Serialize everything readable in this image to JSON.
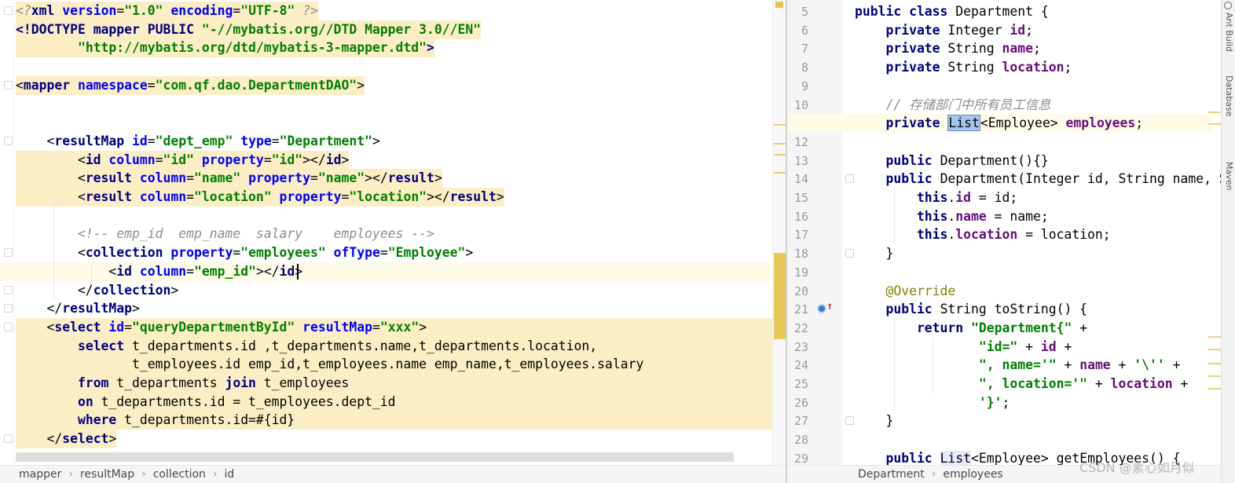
{
  "left_editor": {
    "lines": [
      {
        "segments": [
          {
            "t": "<?",
            "c": "pi"
          },
          {
            "t": "xml ",
            "c": "kw"
          },
          {
            "t": "version",
            "c": "attr"
          },
          {
            "t": "=",
            "c": "pl"
          },
          {
            "t": "\"1.0\" ",
            "c": "val"
          },
          {
            "t": "encoding",
            "c": "attr"
          },
          {
            "t": "=",
            "c": "pl"
          },
          {
            "t": "\"UTF-8\" ",
            "c": "val"
          },
          {
            "t": "?>",
            "c": "pi"
          }
        ]
      },
      {
        "segments": [
          {
            "t": "<!DOCTYPE ",
            "c": "tag"
          },
          {
            "t": "mapper ",
            "c": "tag"
          },
          {
            "t": "PUBLIC ",
            "c": "tag"
          },
          {
            "t": "\"-//mybatis.org//DTD Mapper 3.0//EN\"",
            "c": "val"
          }
        ]
      },
      {
        "segments": [
          {
            "t": "        ",
            "c": "pl"
          },
          {
            "t": "\"http://mybatis.org/dtd/mybatis-3-mapper.dtd\"",
            "c": "val"
          },
          {
            "t": ">",
            "c": "tag"
          }
        ]
      },
      {
        "segments": []
      },
      {
        "segments": [
          {
            "t": "<",
            "c": "pl"
          },
          {
            "t": "mapper ",
            "c": "tag"
          },
          {
            "t": "namespace",
            "c": "attr"
          },
          {
            "t": "=",
            "c": "pl"
          },
          {
            "t": "\"com.qf.dao.DepartmentDAO\"",
            "c": "val"
          },
          {
            "t": ">",
            "c": "pl"
          }
        ]
      },
      {
        "segments": []
      },
      {
        "segments": []
      },
      {
        "segments": [
          {
            "t": "    <",
            "c": "pl"
          },
          {
            "t": "resultMap ",
            "c": "tag"
          },
          {
            "t": "id",
            "c": "attr"
          },
          {
            "t": "=",
            "c": "pl"
          },
          {
            "t": "\"dept_emp\" ",
            "c": "val"
          },
          {
            "t": "type",
            "c": "attr"
          },
          {
            "t": "=",
            "c": "pl"
          },
          {
            "t": "\"Department\"",
            "c": "val"
          },
          {
            "t": ">",
            "c": "pl"
          }
        ]
      },
      {
        "segments": [
          {
            "t": "        <",
            "c": "pl"
          },
          {
            "t": "id ",
            "c": "tag"
          },
          {
            "t": "column",
            "c": "attr"
          },
          {
            "t": "=",
            "c": "pl"
          },
          {
            "t": "\"id\" ",
            "c": "val"
          },
          {
            "t": "property",
            "c": "attr"
          },
          {
            "t": "=",
            "c": "pl"
          },
          {
            "t": "\"id\"",
            "c": "val"
          },
          {
            "t": "></",
            "c": "pl"
          },
          {
            "t": "id",
            "c": "tag"
          },
          {
            "t": ">",
            "c": "pl"
          }
        ]
      },
      {
        "segments": [
          {
            "t": "        <",
            "c": "pl"
          },
          {
            "t": "result ",
            "c": "tag"
          },
          {
            "t": "column",
            "c": "attr"
          },
          {
            "t": "=",
            "c": "pl"
          },
          {
            "t": "\"name\" ",
            "c": "val"
          },
          {
            "t": "property",
            "c": "attr"
          },
          {
            "t": "=",
            "c": "pl"
          },
          {
            "t": "\"name\"",
            "c": "val"
          },
          {
            "t": "></",
            "c": "pl"
          },
          {
            "t": "result",
            "c": "tag"
          },
          {
            "t": ">",
            "c": "pl"
          }
        ]
      },
      {
        "segments": [
          {
            "t": "        <",
            "c": "pl"
          },
          {
            "t": "result ",
            "c": "tag"
          },
          {
            "t": "column",
            "c": "attr"
          },
          {
            "t": "=",
            "c": "pl"
          },
          {
            "t": "\"location\" ",
            "c": "val"
          },
          {
            "t": "property",
            "c": "attr"
          },
          {
            "t": "=",
            "c": "pl"
          },
          {
            "t": "\"location\"",
            "c": "val"
          },
          {
            "t": "></",
            "c": "pl"
          },
          {
            "t": "result",
            "c": "tag"
          },
          {
            "t": ">",
            "c": "pl"
          }
        ]
      },
      {
        "segments": []
      },
      {
        "segments": [
          {
            "t": "        <!-- emp_id  emp_name  salary    employees -->",
            "c": "cmt"
          }
        ]
      },
      {
        "segments": [
          {
            "t": "        <",
            "c": "pl"
          },
          {
            "t": "collection ",
            "c": "tag"
          },
          {
            "t": "property",
            "c": "attr"
          },
          {
            "t": "=",
            "c": "pl"
          },
          {
            "t": "\"employees\" ",
            "c": "val"
          },
          {
            "t": "ofType",
            "c": "attr"
          },
          {
            "t": "=",
            "c": "pl"
          },
          {
            "t": "\"Employee\"",
            "c": "val"
          },
          {
            "t": ">",
            "c": "pl"
          }
        ]
      },
      {
        "segments": [
          {
            "t": "            <",
            "c": "pl"
          },
          {
            "t": "id ",
            "c": "tag"
          },
          {
            "t": "column",
            "c": "attr"
          },
          {
            "t": "=",
            "c": "pl"
          },
          {
            "t": "\"emp_id\"",
            "c": "val"
          },
          {
            "t": "></",
            "c": "pl"
          },
          {
            "t": "id",
            "c": "tag"
          },
          {
            "t": ">",
            "c": "pl"
          }
        ]
      },
      {
        "segments": [
          {
            "t": "        </",
            "c": "pl"
          },
          {
            "t": "collection",
            "c": "tag"
          },
          {
            "t": ">",
            "c": "pl"
          }
        ]
      },
      {
        "segments": [
          {
            "t": "    </",
            "c": "pl"
          },
          {
            "t": "resultMap",
            "c": "tag"
          },
          {
            "t": ">",
            "c": "pl"
          }
        ]
      },
      {
        "segments": [
          {
            "t": "    <",
            "c": "pl"
          },
          {
            "t": "select ",
            "c": "tag"
          },
          {
            "t": "id",
            "c": "attr"
          },
          {
            "t": "=",
            "c": "pl"
          },
          {
            "t": "\"queryDepartmentById\" ",
            "c": "val"
          },
          {
            "t": "resultMap",
            "c": "attr"
          },
          {
            "t": "=",
            "c": "pl"
          },
          {
            "t": "\"xxx\"",
            "c": "val"
          },
          {
            "t": ">",
            "c": "pl"
          }
        ]
      },
      {
        "segments": [
          {
            "t": "        ",
            "c": "pl"
          },
          {
            "t": "select ",
            "c": "kw"
          },
          {
            "t": "t_departments.id ,t_departments.name,t_departments.location,",
            "c": "pl"
          }
        ]
      },
      {
        "segments": [
          {
            "t": "               t_employees.id emp_id,t_employees.name emp_name,t_employees.salary",
            "c": "pl"
          }
        ]
      },
      {
        "segments": [
          {
            "t": "        ",
            "c": "pl"
          },
          {
            "t": "from ",
            "c": "kw"
          },
          {
            "t": "t_departments ",
            "c": "pl"
          },
          {
            "t": "join ",
            "c": "kw"
          },
          {
            "t": "t_employees",
            "c": "pl"
          }
        ]
      },
      {
        "segments": [
          {
            "t": "        ",
            "c": "pl"
          },
          {
            "t": "on ",
            "c": "kw"
          },
          {
            "t": "t_departments.id = t_employees.dept_id",
            "c": "pl"
          }
        ]
      },
      {
        "segments": [
          {
            "t": "        ",
            "c": "pl"
          },
          {
            "t": "where ",
            "c": "kw"
          },
          {
            "t": "t_departments.id=#{id}",
            "c": "pl"
          }
        ]
      },
      {
        "segments": [
          {
            "t": "    </",
            "c": "pl"
          },
          {
            "t": "select",
            "c": "tag"
          },
          {
            "t": ">",
            "c": "pl"
          }
        ]
      }
    ],
    "breadcrumb": [
      "mapper",
      "resultMap",
      "collection",
      "id"
    ]
  },
  "right_editor": {
    "line_numbers": [
      "5",
      "6",
      "7",
      "8",
      "9",
      "10",
      "11",
      "12",
      "13",
      "14",
      "15",
      "16",
      "17",
      "18",
      "19",
      "20",
      "21",
      "22",
      "23",
      "24",
      "25",
      "26",
      "27",
      "28",
      "29"
    ],
    "lines": [
      {
        "segments": [
          {
            "t": "public class ",
            "c": "jkw"
          },
          {
            "t": "Department {",
            "c": "pl"
          }
        ]
      },
      {
        "segments": [
          {
            "t": "    private ",
            "c": "jkw"
          },
          {
            "t": "Integer ",
            "c": "pl"
          },
          {
            "t": "id",
            "c": "fld"
          },
          {
            "t": ";",
            "c": "pl"
          }
        ]
      },
      {
        "segments": [
          {
            "t": "    private ",
            "c": "jkw"
          },
          {
            "t": "String ",
            "c": "pl"
          },
          {
            "t": "name",
            "c": "fld"
          },
          {
            "t": ";",
            "c": "pl"
          }
        ]
      },
      {
        "segments": [
          {
            "t": "    private ",
            "c": "jkw"
          },
          {
            "t": "String ",
            "c": "pl"
          },
          {
            "t": "location",
            "c": "fld"
          },
          {
            "t": ";",
            "c": "pl"
          }
        ]
      },
      {
        "segments": []
      },
      {
        "segments": [
          {
            "t": "    // 存储部门中所有员工信息",
            "c": "cmt"
          }
        ]
      },
      {
        "segments": [
          {
            "t": "    private ",
            "c": "jkw"
          },
          {
            "t": "List",
            "c": "sel"
          },
          {
            "t": "<Employee> ",
            "c": "pl"
          },
          {
            "t": "employees",
            "c": "fld"
          },
          {
            "t": ";",
            "c": "pl"
          }
        ]
      },
      {
        "segments": []
      },
      {
        "segments": [
          {
            "t": "    public ",
            "c": "jkw"
          },
          {
            "t": "Department(){}",
            "c": "pl"
          }
        ]
      },
      {
        "segments": [
          {
            "t": "    public ",
            "c": "jkw"
          },
          {
            "t": "Department(Integer id, String name, String location) {",
            "c": "pl"
          }
        ]
      },
      {
        "segments": [
          {
            "t": "        this",
            "c": "jkw"
          },
          {
            "t": ".",
            "c": "pl"
          },
          {
            "t": "id",
            "c": "fld"
          },
          {
            "t": " = id;",
            "c": "pl"
          }
        ]
      },
      {
        "segments": [
          {
            "t": "        this",
            "c": "jkw"
          },
          {
            "t": ".",
            "c": "pl"
          },
          {
            "t": "name",
            "c": "fld"
          },
          {
            "t": " = name;",
            "c": "pl"
          }
        ]
      },
      {
        "segments": [
          {
            "t": "        this",
            "c": "jkw"
          },
          {
            "t": ".",
            "c": "pl"
          },
          {
            "t": "location",
            "c": "fld"
          },
          {
            "t": " = location;",
            "c": "pl"
          }
        ]
      },
      {
        "segments": [
          {
            "t": "    }",
            "c": "pl"
          }
        ]
      },
      {
        "segments": []
      },
      {
        "segments": [
          {
            "t": "    @Override",
            "c": "ann"
          }
        ]
      },
      {
        "segments": [
          {
            "t": "    public ",
            "c": "jkw"
          },
          {
            "t": "String toString() {",
            "c": "pl"
          }
        ]
      },
      {
        "segments": [
          {
            "t": "        return ",
            "c": "jkw"
          },
          {
            "t": "\"Department{\" ",
            "c": "str"
          },
          {
            "t": "+",
            "c": "pl"
          }
        ]
      },
      {
        "segments": [
          {
            "t": "                ",
            "c": "pl"
          },
          {
            "t": "\"id=\" ",
            "c": "str"
          },
          {
            "t": "+ ",
            "c": "pl"
          },
          {
            "t": "id ",
            "c": "fld"
          },
          {
            "t": "+",
            "c": "pl"
          }
        ]
      },
      {
        "segments": [
          {
            "t": "                ",
            "c": "pl"
          },
          {
            "t": "\", name='\" ",
            "c": "str"
          },
          {
            "t": "+ ",
            "c": "pl"
          },
          {
            "t": "name ",
            "c": "fld"
          },
          {
            "t": "+ ",
            "c": "pl"
          },
          {
            "t": "'\\''",
            "c": "str"
          },
          {
            "t": " +",
            "c": "pl"
          }
        ]
      },
      {
        "segments": [
          {
            "t": "                ",
            "c": "pl"
          },
          {
            "t": "\", location='\" ",
            "c": "str"
          },
          {
            "t": "+ ",
            "c": "pl"
          },
          {
            "t": "location ",
            "c": "fld"
          },
          {
            "t": "+ ",
            "c": "pl"
          }
        ]
      },
      {
        "segments": [
          {
            "t": "                ",
            "c": "pl"
          },
          {
            "t": "'}'",
            "c": "str"
          },
          {
            "t": ";",
            "c": "pl"
          }
        ]
      },
      {
        "segments": [
          {
            "t": "    }",
            "c": "pl"
          }
        ]
      },
      {
        "segments": []
      },
      {
        "segments": [
          {
            "t": "    public ",
            "c": "jkw"
          },
          {
            "t": "List",
            "c": "listref"
          },
          {
            "t": "<Employee> getEmployees() {",
            "c": "pl"
          }
        ]
      }
    ],
    "breadcrumb": [
      "Department",
      "employees"
    ]
  },
  "tool_windows": [
    "Ant Build",
    "Database",
    "Maven"
  ],
  "watermark": "CSDN @素心如月似"
}
